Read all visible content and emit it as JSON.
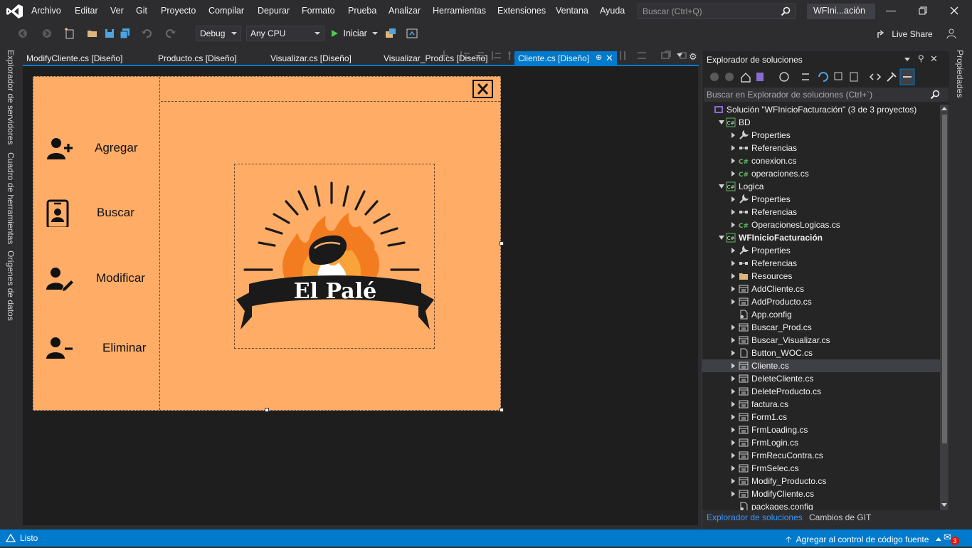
{
  "menu": {
    "items": [
      "Archivo",
      "Editar",
      "Ver",
      "Git",
      "Proyecto",
      "Compilar",
      "Depurar",
      "Formato",
      "Prueba",
      "Analizar",
      "Herramientas",
      "Extensiones",
      "Ventana",
      "Ayuda"
    ],
    "search_placeholder": "Buscar (Ctrl+Q)",
    "window_title": "WFIni...ación"
  },
  "toolbar": {
    "config": "Debug",
    "platform": "Any CPU",
    "start_label": "Iniciar",
    "live_share": "Live Share"
  },
  "left_tabs": [
    "Explorador de servidores",
    "Cuadro de herramientas",
    "Orígenes de datos"
  ],
  "doc_tabs": [
    "ModifyCliente.cs [Diseño]",
    "Producto.cs [Diseño]",
    "Visualizar.cs [Diseño]",
    "Visualizar_Prod.cs [Diseño]",
    "Cliente.cs [Diseño]"
  ],
  "form": {
    "buttons": [
      "Agregar",
      "Buscar",
      "Modificar",
      "Eliminar"
    ],
    "logo_text": "El Palé"
  },
  "solution_explorer": {
    "title": "Explorador de soluciones",
    "search_placeholder": "Buscar en Explorador de soluciones (Ctrl+`)",
    "tree": [
      {
        "label": "Solución \"WFInicioFacturación\" (3 de 3 proyectos)",
        "level": 0,
        "icon": "solution",
        "arrow": "none"
      },
      {
        "label": "BD",
        "level": 1,
        "icon": "csproj",
        "arrow": "expanded"
      },
      {
        "label": "Properties",
        "level": 2,
        "icon": "wrench",
        "arrow": "collapsed"
      },
      {
        "label": "Referencias",
        "level": 2,
        "icon": "refs",
        "arrow": "collapsed"
      },
      {
        "label": "conexion.cs",
        "level": 2,
        "icon": "csfile",
        "arrow": "collapsed"
      },
      {
        "label": "operaciones.cs",
        "level": 2,
        "icon": "csfile",
        "arrow": "collapsed"
      },
      {
        "label": "Logica",
        "level": 1,
        "icon": "csproj",
        "arrow": "expanded"
      },
      {
        "label": "Properties",
        "level": 2,
        "icon": "wrench",
        "arrow": "collapsed"
      },
      {
        "label": "Referencias",
        "level": 2,
        "icon": "refs",
        "arrow": "collapsed"
      },
      {
        "label": "OperacionesLogicas.cs",
        "level": 2,
        "icon": "csfile",
        "arrow": "collapsed"
      },
      {
        "label": "WFInicioFacturación",
        "level": 1,
        "icon": "csproj",
        "arrow": "expanded",
        "bold": true
      },
      {
        "label": "Properties",
        "level": 2,
        "icon": "wrench",
        "arrow": "collapsed"
      },
      {
        "label": "Referencias",
        "level": 2,
        "icon": "refs",
        "arrow": "collapsed"
      },
      {
        "label": "Resources",
        "level": 2,
        "icon": "folder",
        "arrow": "collapsed"
      },
      {
        "label": "AddCliente.cs",
        "level": 2,
        "icon": "form",
        "arrow": "collapsed"
      },
      {
        "label": "AddProducto.cs",
        "level": 2,
        "icon": "form",
        "arrow": "collapsed"
      },
      {
        "label": "App.config",
        "level": 2,
        "icon": "config",
        "arrow": "none"
      },
      {
        "label": "Buscar_Prod.cs",
        "level": 2,
        "icon": "form",
        "arrow": "collapsed"
      },
      {
        "label": "Buscar_Visualizar.cs",
        "level": 2,
        "icon": "form",
        "arrow": "collapsed"
      },
      {
        "label": "Button_WOC.cs",
        "level": 2,
        "icon": "file",
        "arrow": "collapsed"
      },
      {
        "label": "Cliente.cs",
        "level": 2,
        "icon": "form",
        "arrow": "collapsed",
        "selected": true
      },
      {
        "label": "DeleteCliente.cs",
        "level": 2,
        "icon": "form",
        "arrow": "collapsed"
      },
      {
        "label": "DeleteProducto.cs",
        "level": 2,
        "icon": "form",
        "arrow": "collapsed"
      },
      {
        "label": "factura.cs",
        "level": 2,
        "icon": "form",
        "arrow": "collapsed"
      },
      {
        "label": "Form1.cs",
        "level": 2,
        "icon": "form",
        "arrow": "collapsed"
      },
      {
        "label": "FrmLoading.cs",
        "level": 2,
        "icon": "form",
        "arrow": "collapsed"
      },
      {
        "label": "FrmLogin.cs",
        "level": 2,
        "icon": "form",
        "arrow": "collapsed"
      },
      {
        "label": "FrmRecuContra.cs",
        "level": 2,
        "icon": "form",
        "arrow": "collapsed"
      },
      {
        "label": "FrmSelec.cs",
        "level": 2,
        "icon": "form",
        "arrow": "collapsed"
      },
      {
        "label": "Modify_Producto.cs",
        "level": 2,
        "icon": "form",
        "arrow": "collapsed"
      },
      {
        "label": "ModifyCliente.cs",
        "level": 2,
        "icon": "form",
        "arrow": "collapsed"
      },
      {
        "label": "packages.config",
        "level": 2,
        "icon": "config",
        "arrow": "none"
      }
    ],
    "bottom_tabs": [
      "Explorador de soluciones",
      "Cambios de GIT"
    ]
  },
  "right_tab": "Propiedades",
  "status": {
    "text": "Listo",
    "source_control": "Agregar al control de código fuente",
    "notification_count": "3"
  },
  "colors": {
    "accent": "#007acc",
    "form_bg": "#ffac67",
    "ide_bg": "#2d2d30",
    "designer_bg": "#1e1e1e"
  }
}
